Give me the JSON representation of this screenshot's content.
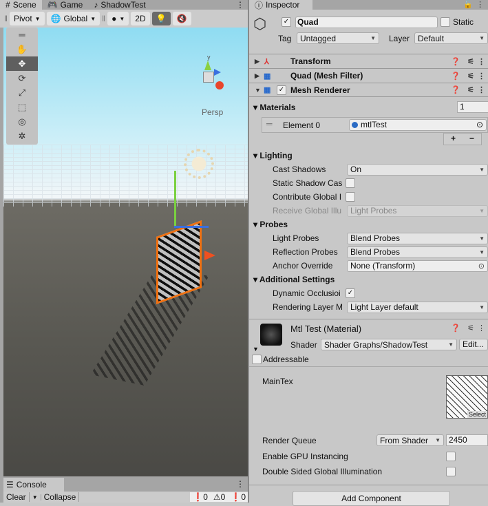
{
  "scene": {
    "tabs": [
      {
        "label": "Scene",
        "icon": "hash-icon"
      },
      {
        "label": "Game",
        "icon": "gamepad-icon"
      },
      {
        "label": "ShadowTest",
        "icon": "music-icon"
      }
    ],
    "toolbar": {
      "pivot": "Pivot",
      "global": "Global",
      "mode_2d": "2D"
    },
    "persp_label": "Persp",
    "gizmo_axis": "y"
  },
  "console": {
    "tab": "Console",
    "clear": "Clear",
    "collapse": "Collapse",
    "info_count": "0",
    "warn_count": "0",
    "error_count": "0"
  },
  "inspector": {
    "tab": "Inspector",
    "object_name": "Quad",
    "static_label": "Static",
    "active": true,
    "static": false,
    "tag_label": "Tag",
    "tag": "Untagged",
    "layer_label": "Layer",
    "layer": "Default",
    "components": [
      {
        "name": "Transform"
      },
      {
        "name": "Quad (Mesh Filter)"
      },
      {
        "name": "Mesh Renderer",
        "enabled": true
      }
    ],
    "materials": {
      "title": "Materials",
      "count": "1",
      "element_label": "Element 0",
      "element_value": "mtlTest",
      "add": "+",
      "remove": "−"
    },
    "lighting": {
      "title": "Lighting",
      "cast_shadows_label": "Cast Shadows",
      "cast_shadows": "On",
      "static_shadow_label": "Static Shadow Cas",
      "contribute_gi_label": "Contribute Global I",
      "receive_gi_label": "Receive Global Illu",
      "receive_gi": "Light Probes"
    },
    "probes": {
      "title": "Probes",
      "light_probes_label": "Light Probes",
      "light_probes": "Blend Probes",
      "reflection_label": "Reflection Probes",
      "reflection": "Blend Probes",
      "anchor_label": "Anchor Override",
      "anchor": "None (Transform)"
    },
    "additional": {
      "title": "Additional Settings",
      "dynamic_occlusion_label": "Dynamic Occlusioi",
      "dynamic_occlusion": true,
      "rendering_layer_label": "Rendering Layer M",
      "rendering_layer": "Light Layer default"
    },
    "material": {
      "title": "Mtl Test (Material)",
      "shader_label": "Shader",
      "shader": "Shader Graphs/ShadowTest",
      "edit": "Edit...",
      "addressable": "Addressable",
      "maintex_label": "MainTex",
      "select": "Select",
      "render_queue_label": "Render Queue",
      "render_queue_mode": "From Shader",
      "render_queue": "2450",
      "gpu_instancing_label": "Enable GPU Instancing",
      "double_sided_label": "Double Sided Global Illumination"
    },
    "add_component": "Add Component"
  }
}
